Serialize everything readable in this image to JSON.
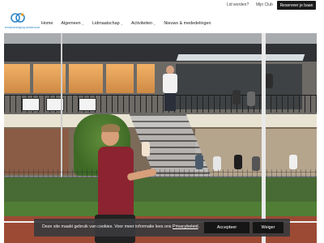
{
  "topbar": {
    "lid_worden": "Lid worden?",
    "mijn_club": "Mijn Club",
    "reserve_label": "Reserveer je baan"
  },
  "logo": {
    "text": "tennisvereniging westervoort"
  },
  "nav": {
    "items": [
      {
        "label": "Home",
        "has_dropdown": false
      },
      {
        "label": "Algemeen",
        "has_dropdown": true
      },
      {
        "label": "Lidmaatschap",
        "has_dropdown": true
      },
      {
        "label": "Activiteiten",
        "has_dropdown": true
      },
      {
        "label": "Nieuws & mededelingen",
        "has_dropdown": false
      }
    ]
  },
  "cookie": {
    "text_prefix": "Deze site maakt gebruik van cookies. Voor meer informatie lees ons ",
    "link": "Privacybeleid",
    "text_suffix": ".",
    "accept_label": "Accepteer",
    "decline_label": "Weiger"
  },
  "icons": {
    "dropdown": "chevron-down-icon",
    "logo": "logo-icon"
  },
  "colors": {
    "logo_blue": "#2f86c6",
    "logo_orange": "#f39a1f",
    "button_dark": "#151515",
    "cookie_bg": "#3a3a3c"
  }
}
